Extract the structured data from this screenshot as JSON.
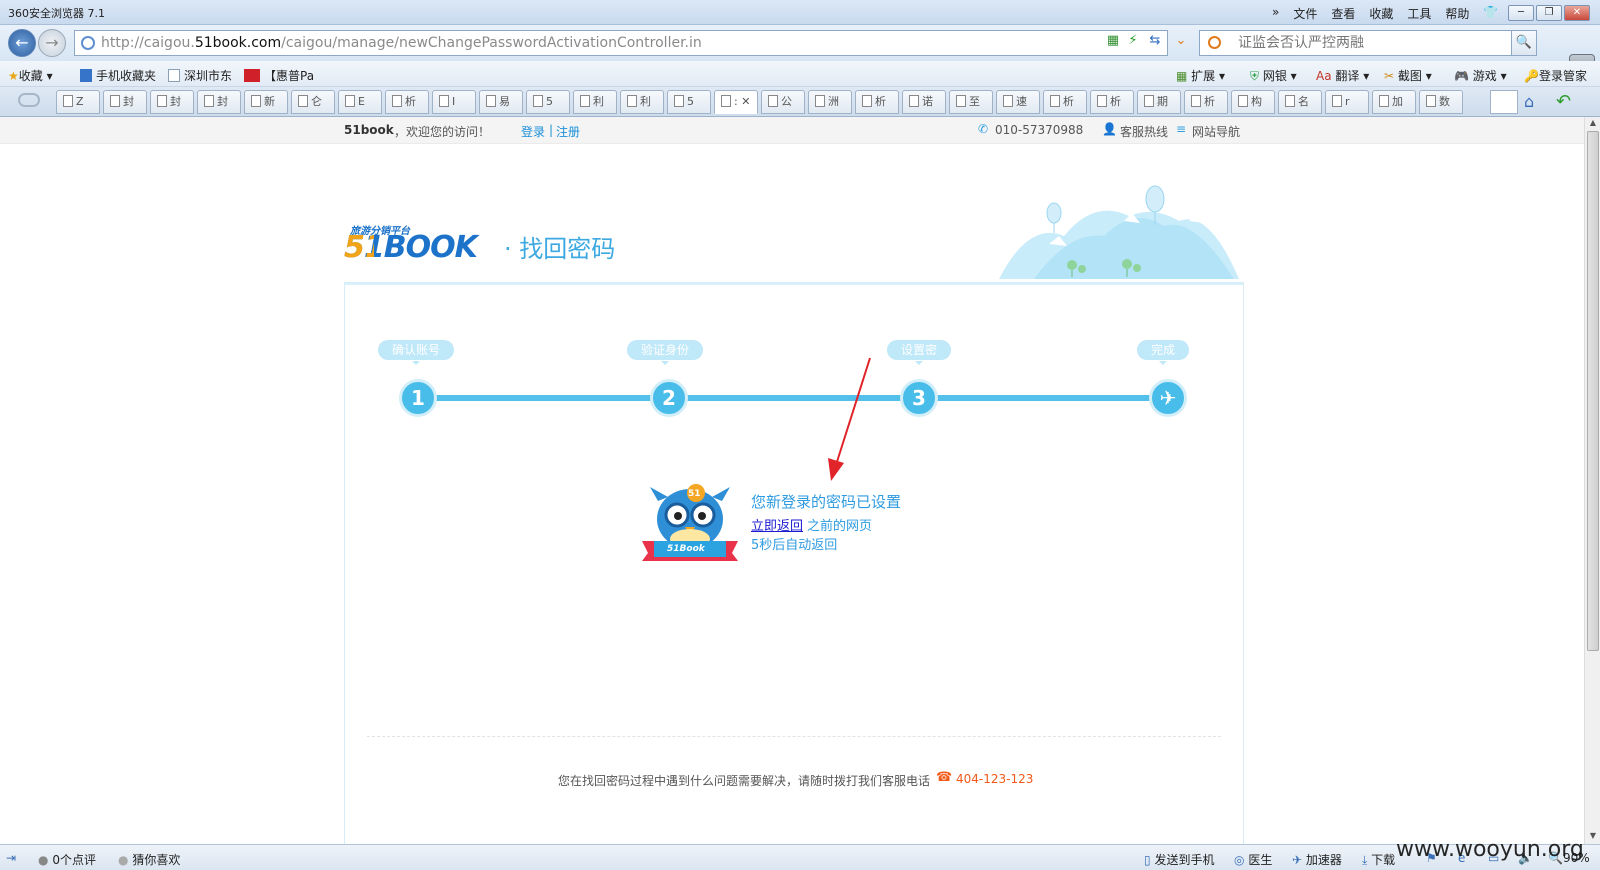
{
  "browser": {
    "title": "360安全浏览器 7.1",
    "menu": [
      "文件",
      "查看",
      "收藏",
      "工具",
      "帮助"
    ],
    "url_prefix": "http://caigou.",
    "url_domain": "51book.com",
    "url_path": "/caigou/manage/newChangePasswordActivationController.in",
    "search_placeholder": "证监会否认严控两融"
  },
  "favorites": [
    "收藏",
    "手机收藏夹",
    "深圳市东",
    "【惠普Pa"
  ],
  "extensions": [
    "扩展",
    "网银",
    "翻译",
    "截图",
    "游戏",
    "登录管家"
  ],
  "tabs": [
    "Z",
    "封",
    "封",
    "封",
    "新",
    "仑",
    "E",
    "析",
    "I",
    "易",
    "5",
    "利",
    "利",
    "5",
    ":",
    "公",
    "洲",
    "析",
    "诺",
    "至",
    "速",
    "析",
    "析",
    "期",
    "析",
    "构",
    "名",
    "r",
    "加",
    "数"
  ],
  "site": {
    "brand": "51book",
    "welcome": "，欢迎您的访问！",
    "login": "登录",
    "sep": "|",
    "register": "注册",
    "phone": "010-57370988",
    "service": "客服热线",
    "sitenav": "网站导航",
    "logo_tag": "旅游分销平台",
    "logo_text": "51BOOK",
    "page_title": "· 找回密码"
  },
  "steps": [
    {
      "label": "确认账号",
      "num": "1"
    },
    {
      "label": "验证身份",
      "num": "2"
    },
    {
      "label": "设置密",
      "num": "3"
    },
    {
      "label": "完成",
      "num": "✈"
    }
  ],
  "result": {
    "mascot_badge": "51",
    "mascot_ribbon": "51Book",
    "heading": "您新登录的密码已设置",
    "link": "立即返回",
    "after_link": "之前的网页",
    "countdown": "5秒后自动返回"
  },
  "footer": {
    "help_text": "您在找回密码过程中遇到什么问题需要解决，请随时拨打我们客服电话",
    "hotline": "404-123-123"
  },
  "status": {
    "reviews": "0个点评",
    "guess": "猜你喜欢",
    "send_phone": "发送到手机",
    "doctor": "医生",
    "accelerator": "加速器",
    "download": "下载",
    "zoom": "90%",
    "watermark": "www.wooyun.org"
  },
  "colors": {
    "accent": "#49bde9",
    "link": "#1a8fd8",
    "hotline": "#f05a1a"
  }
}
